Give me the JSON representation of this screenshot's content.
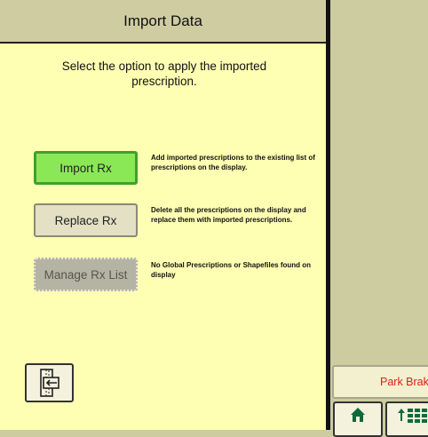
{
  "dialog": {
    "title": "Import Data",
    "instruction": "Select the option to apply the imported prescription."
  },
  "options": [
    {
      "label": "Import Rx",
      "description": "Add imported prescriptions to the existing list of prescriptions on the display.",
      "state": "selected"
    },
    {
      "label": "Replace Rx",
      "description": "Delete all the prescriptions on the display and replace them with imported prescriptions.",
      "state": "enabled"
    },
    {
      "label": "Manage Rx List",
      "description": "No Global Prescriptions or Shapefiles found on display",
      "state": "disabled"
    }
  ],
  "footer": {
    "back_icon": "back-exit-icon",
    "park_brake_label": "Park Brake",
    "home_icon": "home-icon",
    "menu_icon": "up-arrow-menu-icon"
  },
  "colors": {
    "dialog_background": "#feffb2",
    "title_bar": "#cfcca2",
    "selected_button": "#8ae857",
    "selected_border": "#3fa02a",
    "disabled_button": "#b5b4a4",
    "park_brake_text": "#d91e16",
    "right_panel": "#cdcca0"
  }
}
